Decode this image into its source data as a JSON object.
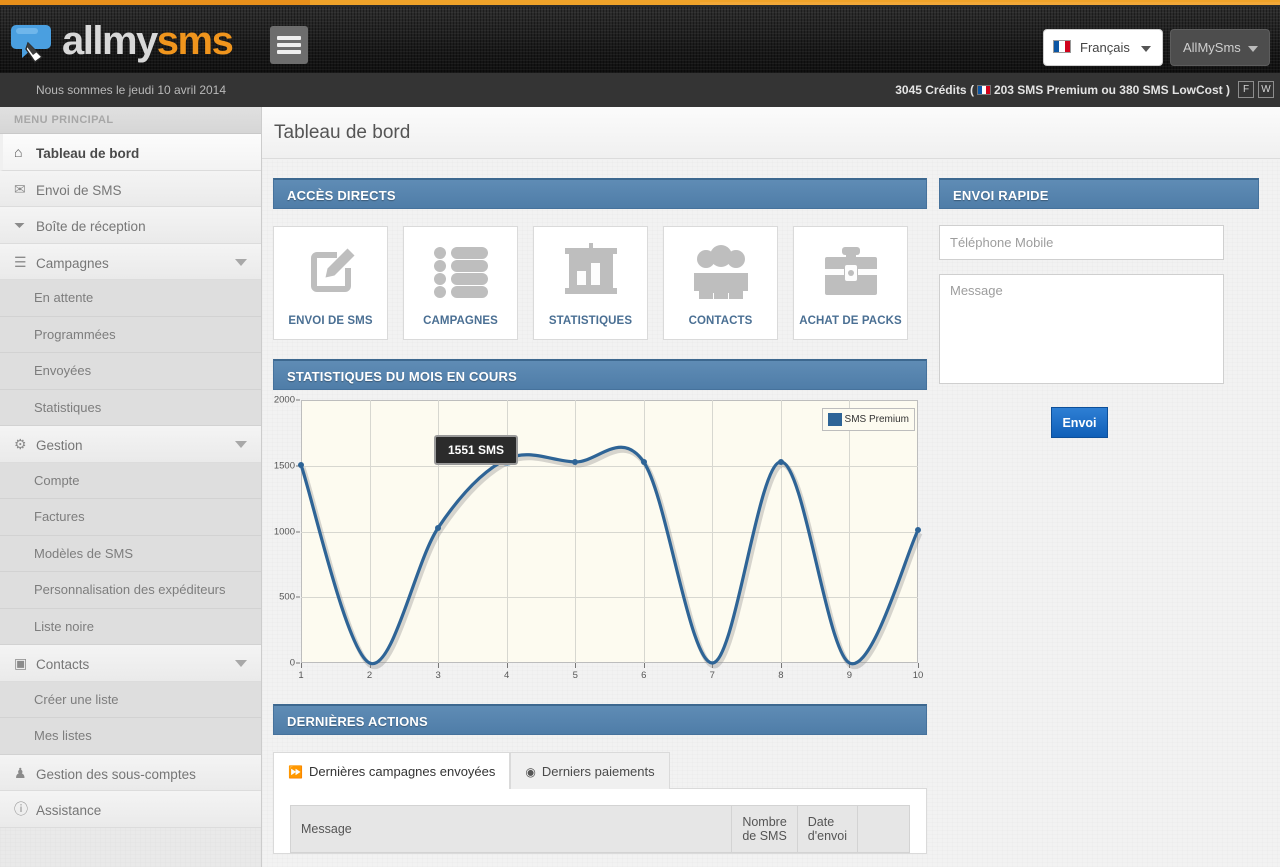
{
  "brand": {
    "name_part1": "allmy",
    "name_part2": "sms"
  },
  "header": {
    "hamburger_icon": "hamburger-icon",
    "language": {
      "label": "Français",
      "flag": "fr"
    },
    "account": {
      "label": "AllMySms"
    }
  },
  "subbar": {
    "date_text": "Nous sommes le jeudi 10 avril 2014",
    "credits_prefix": "3045 Crédits (",
    "credits_detail": "203 SMS Premium ou 380 SMS LowCost )",
    "btn_f": "F",
    "btn_w": "W"
  },
  "sidebar": {
    "title": "MENU PRINCIPAL",
    "items": [
      {
        "label": "Tableau de bord",
        "icon": "home-icon",
        "level": 1,
        "active": true,
        "expandable": false
      },
      {
        "label": "Envoi de SMS",
        "icon": "envelope-icon",
        "level": 1,
        "active": false,
        "expandable": false
      },
      {
        "label": "Boîte de réception",
        "icon": "inbox-icon",
        "level": 1,
        "active": false,
        "expandable": false
      },
      {
        "label": "Campagnes",
        "icon": "list-icon",
        "level": 1,
        "active": false,
        "expandable": true
      },
      {
        "label": "En attente",
        "icon": "",
        "level": 2,
        "active": false,
        "expandable": false
      },
      {
        "label": "Programmées",
        "icon": "",
        "level": 2,
        "active": false,
        "expandable": false
      },
      {
        "label": "Envoyées",
        "icon": "",
        "level": 2,
        "active": false,
        "expandable": false
      },
      {
        "label": "Statistiques",
        "icon": "",
        "level": 2,
        "active": false,
        "expandable": false
      },
      {
        "label": "Gestion",
        "icon": "gear-icon",
        "level": 1,
        "active": false,
        "expandable": true
      },
      {
        "label": "Compte",
        "icon": "",
        "level": 2,
        "active": false,
        "expandable": false
      },
      {
        "label": "Factures",
        "icon": "",
        "level": 2,
        "active": false,
        "expandable": false
      },
      {
        "label": "Modèles de SMS",
        "icon": "",
        "level": 2,
        "active": false,
        "expandable": false
      },
      {
        "label": "Personnalisation des expéditeurs",
        "icon": "",
        "level": 2,
        "active": false,
        "expandable": false
      },
      {
        "label": "Liste noire",
        "icon": "",
        "level": 2,
        "active": false,
        "expandable": false
      },
      {
        "label": "Contacts",
        "icon": "book-icon",
        "level": 1,
        "active": false,
        "expandable": true
      },
      {
        "label": "Créer une liste",
        "icon": "",
        "level": 2,
        "active": false,
        "expandable": false
      },
      {
        "label": "Mes listes",
        "icon": "",
        "level": 2,
        "active": false,
        "expandable": false
      },
      {
        "label": "Gestion des sous-comptes",
        "icon": "user-icon",
        "level": 1,
        "active": false,
        "expandable": false
      },
      {
        "label": "Assistance",
        "icon": "info-icon",
        "level": 1,
        "active": false,
        "expandable": false
      }
    ]
  },
  "page": {
    "title": "Tableau de bord"
  },
  "quick_access": {
    "panel_title": "ACCÈS DIRECTS",
    "tiles": [
      {
        "label": "ENVOI DE SMS",
        "icon": "compose-icon"
      },
      {
        "label": "CAMPAGNES",
        "icon": "list-icon"
      },
      {
        "label": "STATISTIQUES",
        "icon": "bar-chart-icon"
      },
      {
        "label": "CONTACTS",
        "icon": "users-icon"
      },
      {
        "label": "ACHAT DE PACKS",
        "icon": "briefcase-icon"
      }
    ]
  },
  "stats": {
    "panel_title": "STATISTIQUES DU MOIS EN COURS",
    "tooltip": "1551 SMS"
  },
  "chart_data": {
    "type": "line",
    "title": "STATISTIQUES DU MOIS EN COURS",
    "xlabel": "",
    "ylabel": "",
    "x": [
      1,
      2,
      3,
      4,
      5,
      6,
      7,
      8,
      9,
      10
    ],
    "xticklabels": [
      "1",
      "2",
      "3",
      "4",
      "5",
      "6",
      "7",
      "8",
      "9",
      "10"
    ],
    "yticks": [
      0,
      500,
      1000,
      1500,
      2000
    ],
    "yticklabels": [
      "0",
      "500",
      "1000",
      "1500",
      "2000"
    ],
    "ylim": [
      0,
      2000
    ],
    "xlim": [
      1,
      10
    ],
    "grid": true,
    "legend_position": "top-right",
    "series": [
      {
        "name": "SMS Premium",
        "color": "#2e6496",
        "values": [
          1507,
          0,
          1028,
          1551,
          1529,
          1528,
          0,
          1530,
          0,
          1010
        ]
      }
    ],
    "annotations": [
      {
        "text": "1551 SMS",
        "x": 4,
        "y": 1551,
        "highlighted_point": true
      }
    ]
  },
  "last_actions": {
    "panel_title": "DERNIÈRES ACTIONS",
    "tabs": [
      {
        "label": "Dernières campagnes envoyées",
        "icon": "forward-icon",
        "active": true
      },
      {
        "label": "Derniers paiements",
        "icon": "eye-icon",
        "active": false
      }
    ],
    "table": {
      "columns": [
        "Message",
        "Nombre de SMS",
        "Date d'envoi",
        ""
      ],
      "rows": []
    }
  },
  "quick_send": {
    "panel_title": "ENVOI RAPIDE",
    "phone_placeholder": "Téléphone Mobile",
    "phone_value": "",
    "message_placeholder": "Message",
    "message_value": "",
    "submit_label": "Envoi"
  },
  "colors": {
    "panel_blue": "#4f7da8",
    "accent_orange": "#f0a32a",
    "chart_line": "#2e6496",
    "button_blue": "#0f5fb8"
  }
}
